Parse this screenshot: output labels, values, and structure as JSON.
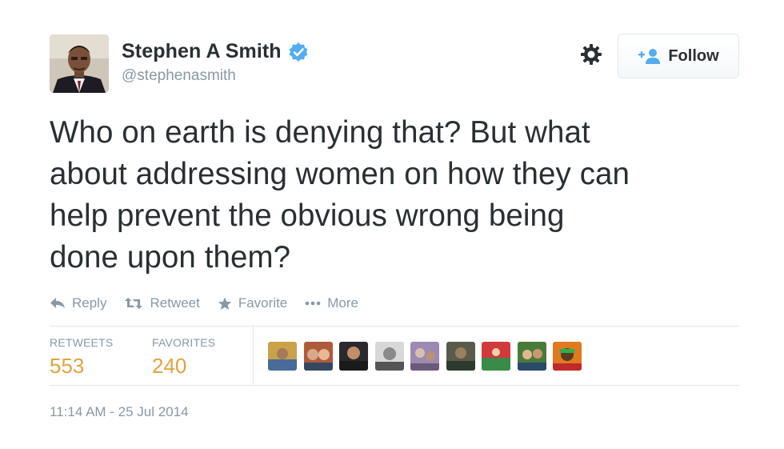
{
  "author": {
    "name": "Stephen A Smith",
    "handle": "@stephenasmith",
    "verified": true
  },
  "follow_button": {
    "label": "Follow"
  },
  "tweet": {
    "lines": [
      "Who on earth is denying that? But what",
      "about addressing women on how they can",
      "help prevent the obvious wrong being",
      "done upon them?"
    ]
  },
  "actions": {
    "reply": "Reply",
    "retweet": "Retweet",
    "favorite": "Favorite",
    "more": "More"
  },
  "stats": {
    "retweets_label": "RETWEETS",
    "retweets_value": "553",
    "favorites_label": "FAVORITES",
    "favorites_value": "240"
  },
  "timestamp": "11:14 AM - 25 Jul 2014",
  "colors": {
    "accent_verified": "#55acee",
    "stat_value": "#e0a340",
    "muted_text": "#8899a6"
  }
}
